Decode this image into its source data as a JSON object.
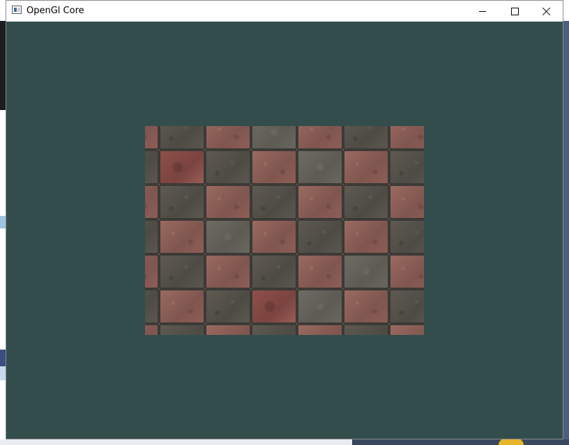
{
  "window": {
    "title": "OpenGl Core"
  },
  "controls": {
    "minimize": "minimize",
    "maximize": "maximize",
    "close": "close"
  },
  "colors": {
    "clear_color": "#334d4d",
    "title_bar": "#ffffff"
  },
  "icons": {
    "app": "window-app-icon",
    "minimize": "minimize-icon",
    "maximize": "maximize-icon",
    "close": "close-icon"
  },
  "texture": {
    "pattern": [
      "red",
      "grey",
      "red",
      "grey",
      "red",
      "grey",
      "red",
      "grey",
      "grey",
      "red",
      "grey",
      "red",
      "grey",
      "red",
      "grey",
      "red",
      "red",
      "grey",
      "red",
      "grey",
      "red",
      "grey",
      "red",
      "grey",
      "grey",
      "red",
      "grey",
      "red",
      "grey",
      "red",
      "grey",
      "red",
      "red",
      "grey",
      "red",
      "grey",
      "red",
      "grey",
      "red",
      "grey",
      "grey",
      "red",
      "grey",
      "red",
      "grey",
      "red",
      "grey",
      "red",
      "red",
      "grey",
      "red",
      "grey",
      "red",
      "grey",
      "red",
      "grey"
    ]
  }
}
